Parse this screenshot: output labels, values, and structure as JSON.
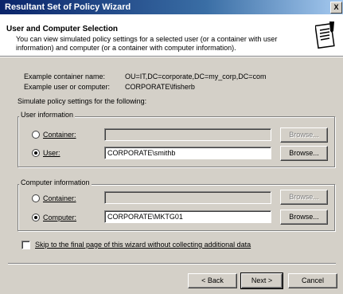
{
  "window": {
    "title": "Resultant Set of Policy Wizard",
    "close_glyph": "X"
  },
  "header": {
    "title": "User and Computer Selection",
    "description": "You can view simulated policy settings for a selected user (or a container with user information) and computer (or a container with computer information).",
    "icon": "wizard-document-icon"
  },
  "examples": {
    "container_label": "Example container name:",
    "container_value": "OU=IT,DC=corporate,DC=my_corp,DC=com",
    "user_label": "Example user or computer:",
    "user_value": "CORPORATE\\lfisherb"
  },
  "simulate_text": "Simulate policy settings for the following:",
  "user_info": {
    "group_label": "User information",
    "container_label": "Container:",
    "container_value": "",
    "user_label": "User:",
    "user_value": "CORPORATE\\smithb",
    "browse_label": "Browse...",
    "selected": "user"
  },
  "computer_info": {
    "group_label": "Computer information",
    "container_label": "Container:",
    "container_value": "",
    "computer_label": "Computer:",
    "computer_value": "CORPORATE\\MKTG01",
    "browse_label": "Browse...",
    "selected": "computer"
  },
  "skip_checkbox": {
    "label": "Skip to the final page of this wizard without collecting additional data",
    "checked": false
  },
  "buttons": {
    "back": "< Back",
    "next": "Next >",
    "cancel": "Cancel"
  }
}
